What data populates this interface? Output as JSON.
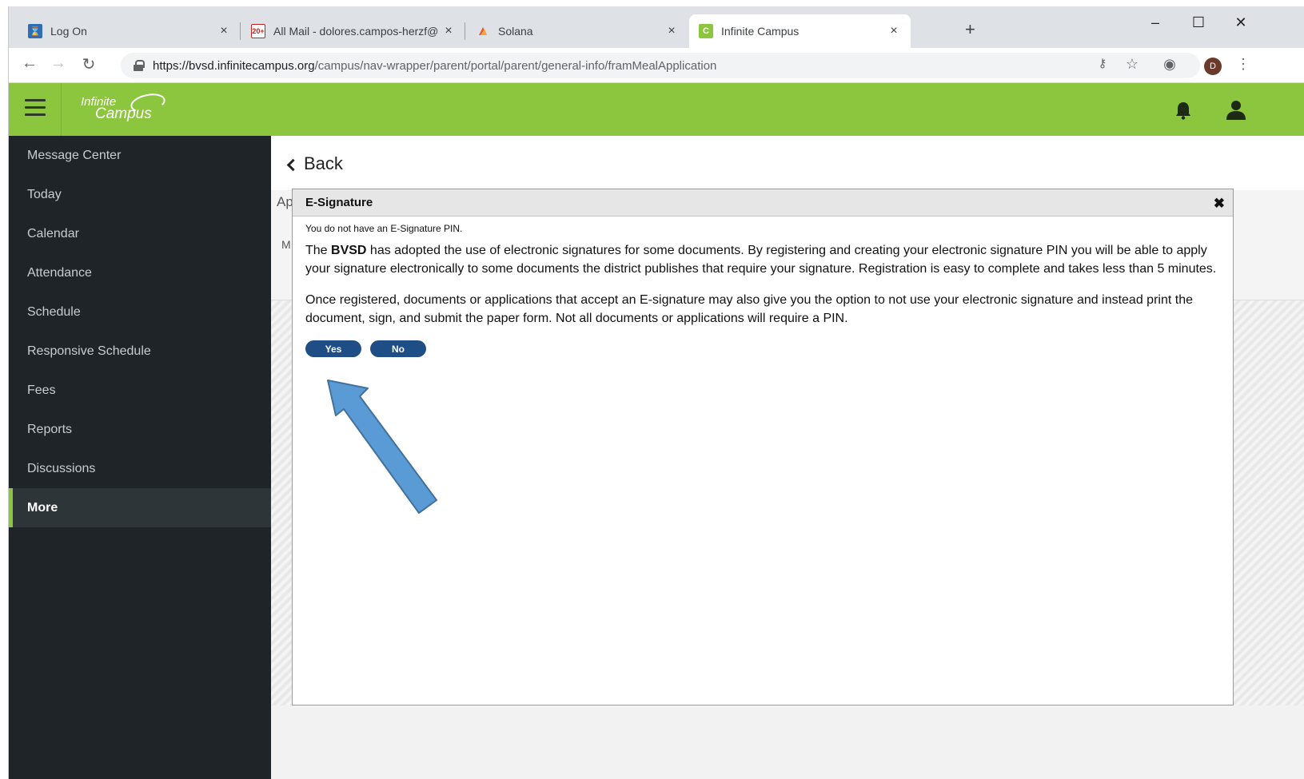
{
  "browser": {
    "tabs": [
      {
        "title": "Log On",
        "favicon": "log-on-favicon"
      },
      {
        "title": "All Mail - dolores.campos-herzf@",
        "favicon": "gmail-icon",
        "badge": "20+"
      },
      {
        "title": "Solana",
        "favicon": "solana-icon"
      },
      {
        "title": "Infinite Campus",
        "favicon": "campus-icon",
        "favicon_letter": "C"
      }
    ],
    "new_tab": "+",
    "close_glyph": "×",
    "window_controls": {
      "minimize": "–",
      "maximize": "☐",
      "close": "✕"
    },
    "url_host": "https://bvsd.infinitecampus.org",
    "url_path": "/campus/nav-wrapper/parent/portal/parent/general-info/framMealApplication",
    "profile_initial": "D"
  },
  "app": {
    "logo_line1": "Infinite",
    "logo_line2": "Campus",
    "accent_color": "#8cc63e"
  },
  "sidebar": {
    "items": [
      {
        "label": "Message Center"
      },
      {
        "label": "Today"
      },
      {
        "label": "Calendar"
      },
      {
        "label": "Attendance"
      },
      {
        "label": "Schedule"
      },
      {
        "label": "Responsive Schedule"
      },
      {
        "label": "Fees"
      },
      {
        "label": "Reports"
      },
      {
        "label": "Discussions"
      },
      {
        "label": "More"
      }
    ],
    "active": "More"
  },
  "main": {
    "back_label": "Back",
    "bg_label_1": "Ap",
    "bg_label_2": "M"
  },
  "dialog": {
    "title": "E-Signature",
    "close": "✖",
    "pin_note": "You do not have an E-Signature PIN.",
    "para1_prefix": "The ",
    "para1_bold": "BVSD",
    "para1_rest": " has adopted the use of electronic signatures for some documents. By registering and creating your electronic signature PIN you will be able to apply your signature electronically to some documents the district publishes that require your signature. Registration is easy to complete and takes less than 5 minutes.",
    "para2": "Once registered, documents or applications that accept an E-signature may also give you the option to not use your electronic signature and instead print the document, sign, and submit the paper form. Not all documents or applications will require a PIN.",
    "yes_label": "Yes",
    "no_label": "No",
    "button_color": "#1e4e85"
  },
  "annotation": {
    "arrow_color": "#5b9bd5"
  }
}
